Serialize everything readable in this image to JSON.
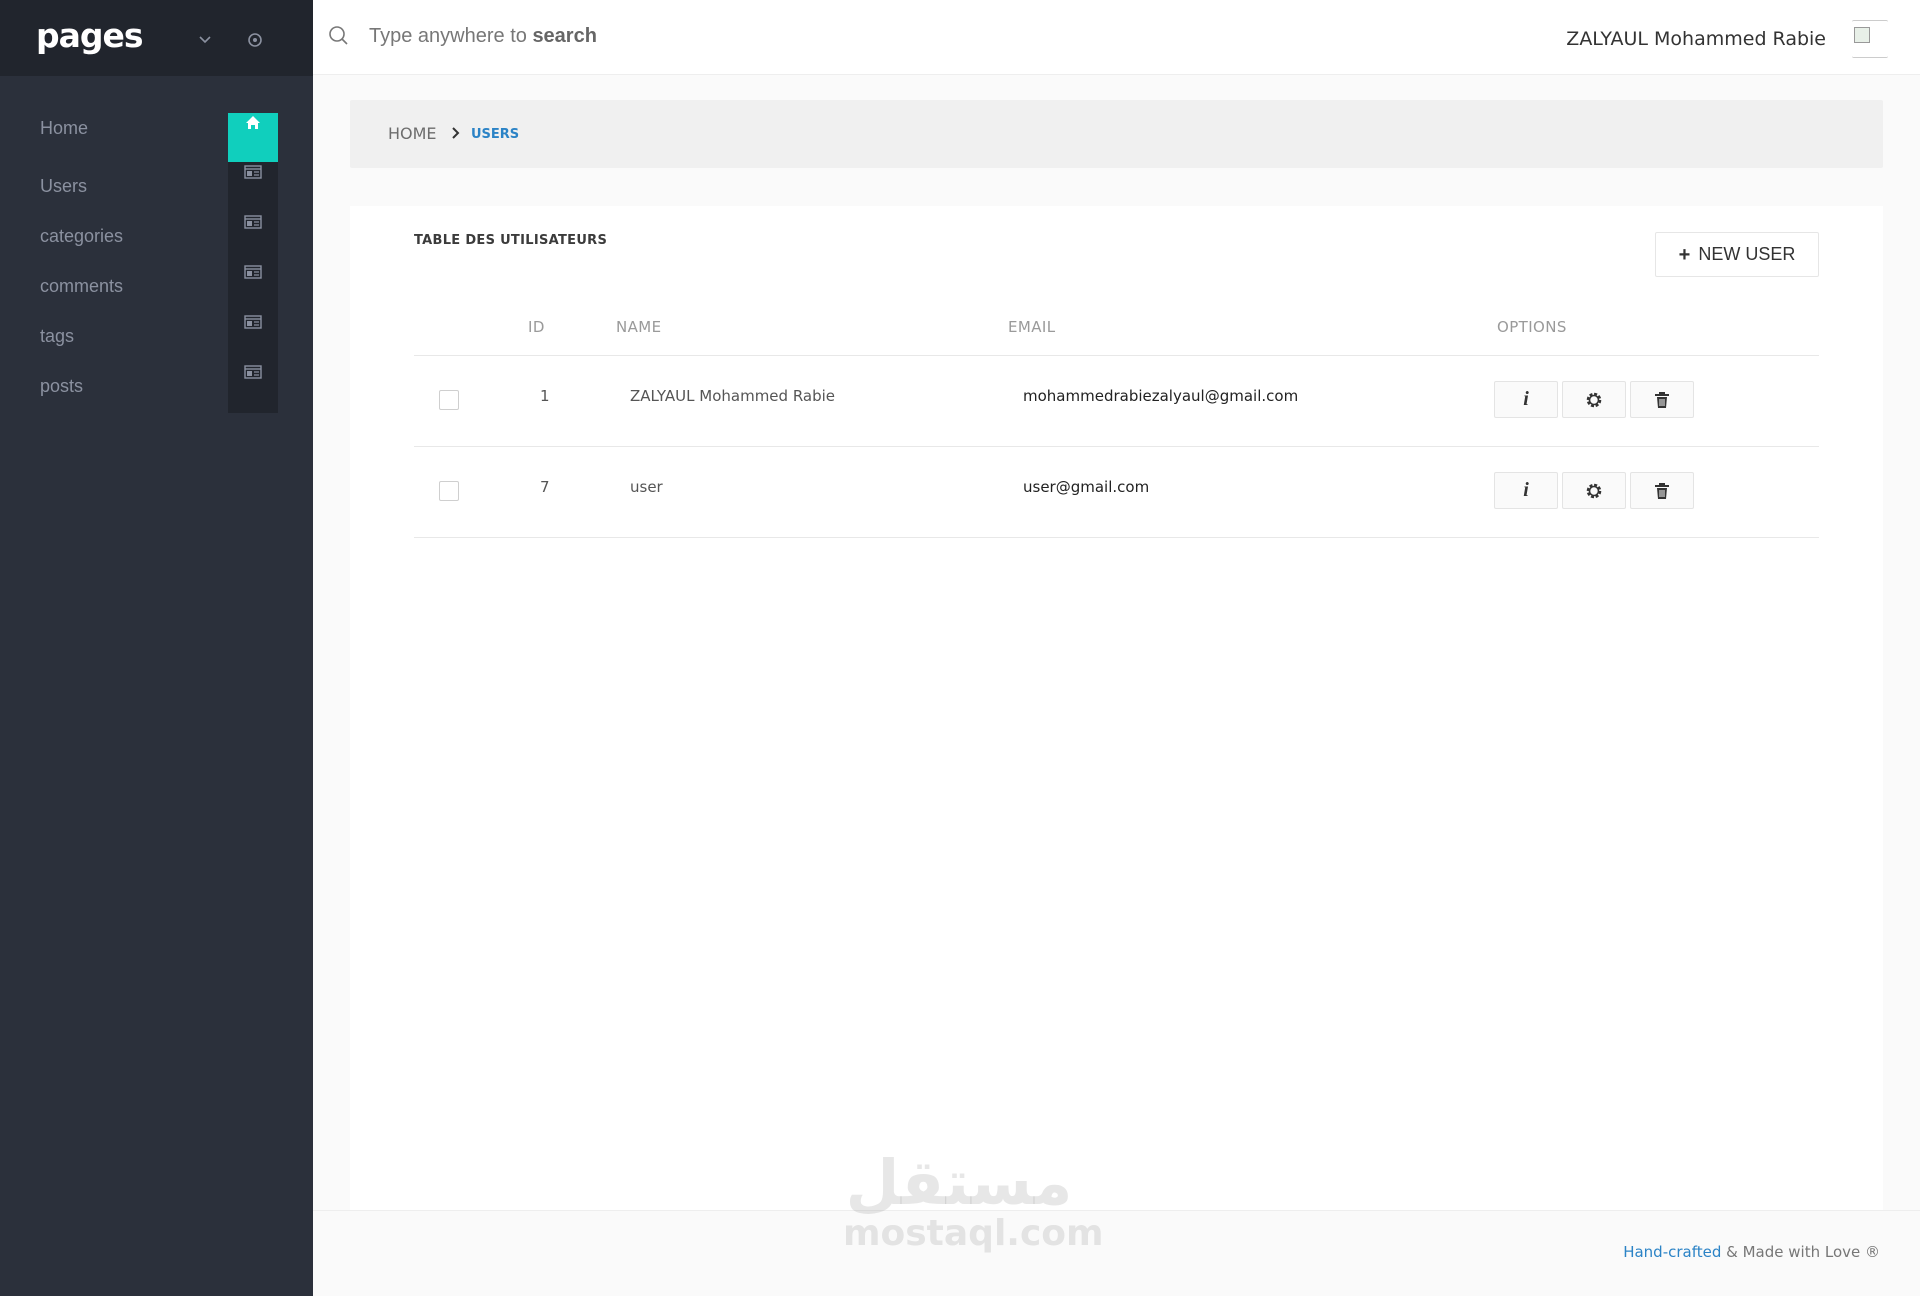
{
  "sidebar": {
    "brand": "pages",
    "items": [
      {
        "label": "Home"
      },
      {
        "label": "Users"
      },
      {
        "label": "categories"
      },
      {
        "label": "comments"
      },
      {
        "label": "tags"
      },
      {
        "label": "posts"
      }
    ],
    "accent_color": "#10cfbd",
    "background_color": "#2b303b"
  },
  "header": {
    "search_placeholder_prefix": "Type anywhere to",
    "search_placeholder_bold": "search",
    "user_name": "ZALYAUL Mohammed Rabie"
  },
  "breadcrumb": {
    "home": "HOME",
    "current": "USERS"
  },
  "card": {
    "title": "TABLE DES UTILISATEURS",
    "new_user_label": "NEW USER",
    "columns": {
      "id": "ID",
      "name": "NAME",
      "email": "EMAIL",
      "options": "OPTIONS"
    },
    "rows": [
      {
        "id": "1",
        "name": "ZALYAUL Mohammed Rabie",
        "email": "mohammedrabiezalyaul@gmail.com"
      },
      {
        "id": "7",
        "name": "user",
        "email": "user@gmail.com"
      }
    ],
    "option_icons": [
      "info-icon",
      "gear-icon",
      "trash-icon"
    ]
  },
  "footer": {
    "link_text": "Hand-crafted",
    "rest_text": " & Made with Love ®"
  },
  "watermark": {
    "arabic": "مستقل",
    "latin": "mostaql.com"
  }
}
